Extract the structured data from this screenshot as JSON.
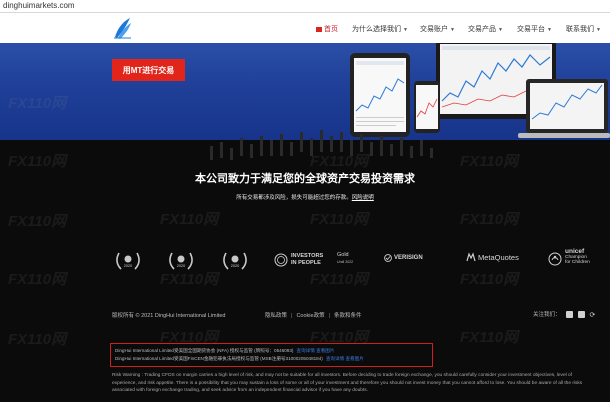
{
  "browser": {
    "url": "dinghuimarkets.com"
  },
  "nav": {
    "items": [
      {
        "label": "首页",
        "active": true
      },
      {
        "label": "为什么选择我们",
        "caret": true
      },
      {
        "label": "交易账户",
        "caret": true
      },
      {
        "label": "交易产品",
        "caret": true
      },
      {
        "label": "交易平台",
        "caret": true
      },
      {
        "label": "联系我们",
        "caret": true
      }
    ]
  },
  "hero": {
    "cta_label": "用MT进行交易"
  },
  "intro": {
    "headline": "本公司致力于满足您的全球资产交易投资需求",
    "risk_text": "所有交易都涉及风险，损失可能超过您的存款。",
    "risk_link": "风险说明"
  },
  "awards": {
    "years": [
      "2020",
      "2020",
      "2020",
      "2021"
    ],
    "investors": {
      "line1": "INVESTORS",
      "line2": "IN PEOPLE",
      "gold": "Gold",
      "gold_sub": "Until 2022"
    },
    "verisign": "VERISIGN",
    "metaquotes": "MetaQuotes",
    "unicef": {
      "line1": "unicef",
      "line2": "Champion",
      "line3": "for Children"
    }
  },
  "footer": {
    "copyright": "版权所有 © 2021 DingHui International Limited",
    "links": [
      "隐私政策",
      "Cookie政策",
      "条款和条件"
    ],
    "follow_label": "关注我们：",
    "social_icons": [
      "facebook-icon",
      "twitter-icon",
      "share-icon"
    ]
  },
  "regulation": {
    "line1": "DingHui International Limited受美国全国期货协会 (NFA) 授权与监管 (牌照号：0546093)",
    "line1_link": "查询详情 查看图片",
    "line2": "DingHui International Limited受美国FinCEN金融犯罪执法局授权与监管 (MSB注册号31000205048184)",
    "line2_link": "查询详情 查看图片"
  },
  "warning": {
    "text": "Risk Warning : Trading CFDS on margin carries a high level of risk, and may not be suitable for all investors. Before deciding to trade foreign exchange, you should carefully consider your investment objectives, level of experience, and risk appetite. There is a possibility that you may sustain a loss of some or all of your investment and therefore you should not invest money that you cannot afford to lose. You should be aware of all the risks associated with foreign exchange trading, and seek advice from an independent financial advisor if you have any doubts."
  },
  "watermark": "FX110网",
  "colors": {
    "brand_red": "#e1251b",
    "hero_blue": "#2b4fa8",
    "link_blue": "#3a7be0",
    "box_red": "#d0201e"
  }
}
